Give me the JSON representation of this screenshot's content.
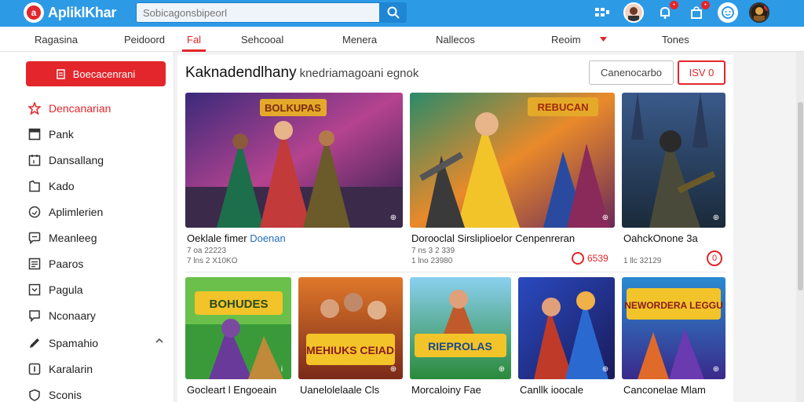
{
  "app": {
    "title": "ApliklKhar"
  },
  "search": {
    "placeholder": "Sobicagonsbipeorl",
    "value": ""
  },
  "header_icons": [
    "grid-icon",
    "avatar-icon",
    "notification-icon",
    "bag-icon",
    "settings-icon",
    "profile-avatar-icon"
  ],
  "categories": [
    {
      "label": "Ragasina",
      "active": false
    },
    {
      "label": "Peidoord",
      "active": false
    },
    {
      "label": "Fal",
      "active": true
    },
    {
      "label": "Sehcooal",
      "active": false
    },
    {
      "label": "Menera",
      "active": false
    },
    {
      "label": "Nallecos",
      "active": false
    },
    {
      "label": "Reoim",
      "active": false
    },
    {
      "label": "Tones",
      "active": false
    }
  ],
  "sidebar": {
    "primary_button": "Boecacenrani",
    "items": [
      {
        "label": "Dencanarian",
        "icon": "star-icon",
        "active": true
      },
      {
        "label": "Pank",
        "icon": "window-icon",
        "active": false
      },
      {
        "label": "Dansallang",
        "icon": "calendar-icon",
        "active": false
      },
      {
        "label": "Kado",
        "icon": "bookmark-icon",
        "active": false
      },
      {
        "label": "Aplimlerien",
        "icon": "clock-icon",
        "active": false
      },
      {
        "label": "Meanleeg",
        "icon": "chat-icon",
        "active": false
      },
      {
        "label": "Paaros",
        "icon": "list-icon",
        "active": false
      },
      {
        "label": "Pagula",
        "icon": "chevron-box-icon",
        "active": false
      },
      {
        "label": "Nconaary",
        "icon": "chat-bubble-icon",
        "active": false
      },
      {
        "label": "Spamahio",
        "icon": "pencil-icon",
        "active": false
      },
      {
        "label": "Karalarin",
        "icon": "tag-icon",
        "active": false
      },
      {
        "label": "Sconis",
        "icon": "shield-icon",
        "active": false
      }
    ]
  },
  "main": {
    "title": "Kaknadendlhany",
    "subtitle": "knedriamagoani egnok",
    "secondary_button": "Canenocarbo",
    "action_button": "ISV 0",
    "row1": [
      {
        "title_a": "Oeklale fimer ",
        "title_b": "Doenan",
        "meta_1": "7 oa 22223",
        "meta_2": "7 lns 2 X10KO",
        "price": ""
      },
      {
        "title_a": "Dorooclal Sirsliplioelor Cenpenreran",
        "title_b": "",
        "meta_1": "7 ns 3 2 339",
        "meta_2": "1 lno 23980",
        "price": "6539"
      },
      {
        "title_a": "OahckOnone 3a",
        "title_b": "",
        "meta_1": "",
        "meta_2": "1 llc 32129",
        "price": "0"
      }
    ],
    "row2": [
      {
        "title": "Gocleart l Engoeain",
        "banner": "BOHUDES"
      },
      {
        "title": "Uanelolelaale Cls",
        "banner": "MEHIUKS CEIAD"
      },
      {
        "title": "Morcaloiny Fae",
        "banner": "RIEPROLAS"
      },
      {
        "title": "Canllk ioocale",
        "banner": ""
      },
      {
        "title": "Canconelae Mlam",
        "banner": "NEWORDERA LEGGU"
      }
    ],
    "row1_banners": [
      "BOLKUPAS",
      "REBUCAN",
      ""
    ]
  }
}
